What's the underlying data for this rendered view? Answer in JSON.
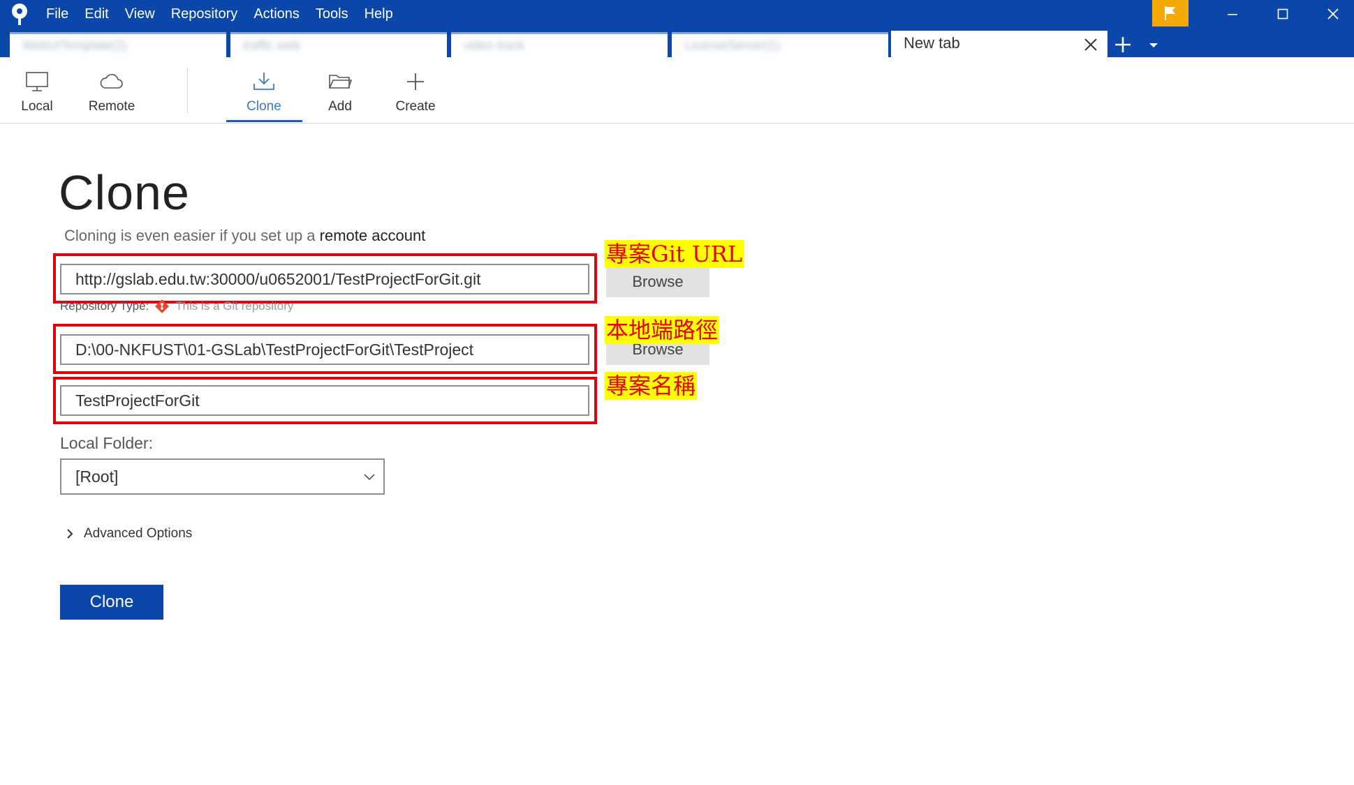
{
  "menu": [
    "File",
    "Edit",
    "View",
    "Repository",
    "Actions",
    "Tools",
    "Help"
  ],
  "tabs": {
    "blurred": [
      "WebUITemplate(2)",
      "traffic web",
      "video track",
      "LicenseServer(1)"
    ],
    "active": "New tab"
  },
  "toolbar": {
    "local": "Local",
    "remote": "Remote",
    "clone": "Clone",
    "add": "Add",
    "create": "Create"
  },
  "page": {
    "title": "Clone",
    "subtitle_prefix": "Cloning is even easier if you set up a ",
    "subtitle_link": "remote account"
  },
  "form": {
    "url_value": "http://gslab.edu.tw:30000/u0652001/TestProjectForGit.git",
    "browse_label": "Browse",
    "repo_type_label": "Repository Type:",
    "repo_type_note": "This is a Git repository",
    "path_value": "D:\\00-NKFUST\\01-GSLab\\TestProjectForGit\\TestProject",
    "name_value": "TestProjectForGit",
    "local_folder_label": "Local Folder:",
    "local_folder_value": "[Root]",
    "advanced_label": "Advanced Options",
    "clone_button": "Clone"
  },
  "annotations": {
    "url_note": "專案Git URL",
    "path_note": "本地端路徑",
    "name_note": "專案名稱"
  },
  "colors": {
    "titlebar": "#0a47a8",
    "flag": "#f5a800",
    "highlight_border": "#e0000b",
    "annotation_bg": "#ffff00",
    "annotation_text": "#e8000a",
    "accent": "#1e5bb8"
  }
}
